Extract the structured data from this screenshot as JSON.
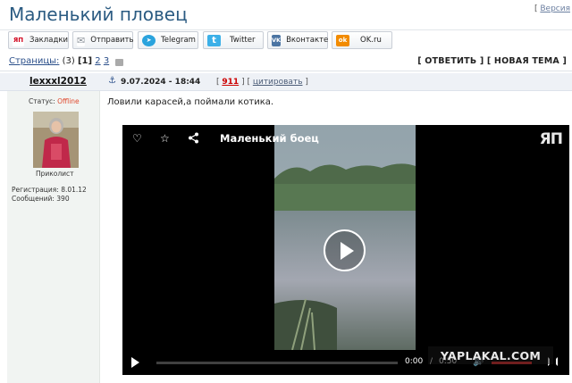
{
  "page": {
    "title": "Маленький пловец",
    "version_open": "[",
    "version_link": "Версия"
  },
  "share": [
    {
      "label": "Закладки",
      "icon": "yaplakal-bookmark-icon",
      "icon_text": "ЯП",
      "color": "#d0021b"
    },
    {
      "label": "Отправить",
      "icon": "envelope-icon",
      "icon_text": "✉",
      "color": "#8a9199"
    },
    {
      "label": "Telegram",
      "icon": "telegram-icon",
      "icon_text": "➤",
      "color": "#2aa3dd"
    },
    {
      "label": "Twitter",
      "icon": "twitter-icon",
      "icon_text": "t",
      "color": "#3cb0e8"
    },
    {
      "label": "Вконтакте",
      "icon": "vk-icon",
      "icon_text": "VK",
      "color": "#4c75a3"
    },
    {
      "label": "OK.ru",
      "icon": "odnoklassniki-icon",
      "icon_text": "ok",
      "color": "#f28b00"
    }
  ],
  "pagination": {
    "label": "Страницы:",
    "total": "(3)",
    "current": "[1]",
    "p2": "2",
    "p3": "3"
  },
  "actions": {
    "reply": "[ ОТВЕТИТЬ ]",
    "new_topic": "[ НОВАЯ ТЕМА ]"
  },
  "post": {
    "author": "lexxxl2012",
    "date": "9.07.2024 - 18:44",
    "rating_open": "[",
    "rating": "911",
    "rating_close": "]",
    "quote_open": "[",
    "quote": "цитировать",
    "quote_close": "]",
    "status_label": "Статус:",
    "status_value": "Offline",
    "user_title": "Приколист",
    "registration": "Регистрация: 8.01.12",
    "messages": "Сообщений: 390",
    "text": "Ловили карасей,а поймали котика."
  },
  "video": {
    "title": "Маленький боец",
    "logo": "ЯП",
    "time_current": "0:00",
    "time_sep": "/",
    "time_total": "0:50",
    "volume_level": 1.0,
    "progress": 0.0
  },
  "watermark": "YAPLAKAL.COM"
}
